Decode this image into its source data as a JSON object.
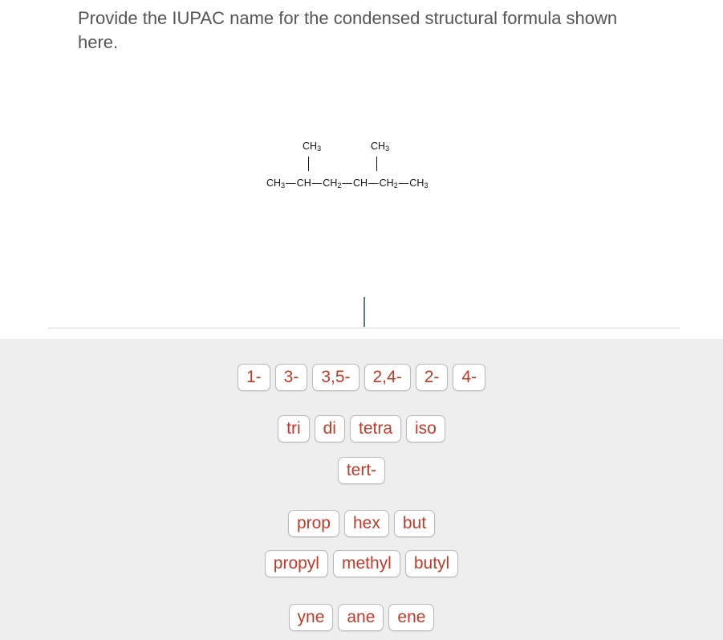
{
  "question": {
    "text": "Provide the IUPAC name for the condensed structural formula shown here."
  },
  "structure": {
    "branch_1": "CH3",
    "branch_2": "CH3",
    "main_chain": [
      "CH3",
      "CH",
      "CH2",
      "CH",
      "CH2",
      "CH3"
    ]
  },
  "answer": {
    "value": ""
  },
  "palette": {
    "locants": [
      "1-",
      "3-",
      "3,5-",
      "2,4-",
      "2-",
      "4-"
    ],
    "multipliers": [
      "tri",
      "di",
      "tetra",
      "iso"
    ],
    "prefixes": [
      "tert-"
    ],
    "roots": [
      "prop",
      "hex",
      "but"
    ],
    "substituents": [
      "propyl",
      "methyl",
      "butyl"
    ],
    "suffixes": [
      "yne",
      "ane",
      "ene"
    ]
  },
  "colors": {
    "tile_text": "#c0392b",
    "palette_bg": "#eeeeee",
    "cursor": "#5a7a8c"
  }
}
